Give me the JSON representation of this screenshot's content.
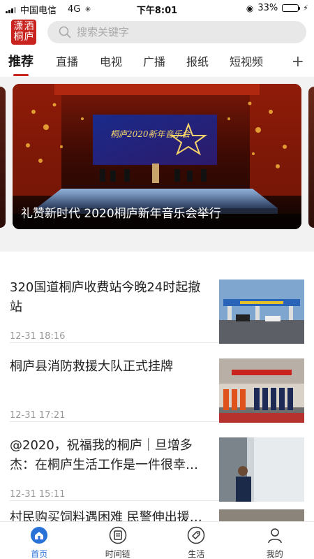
{
  "status_bar": {
    "carrier": "中国电信",
    "network": "4G",
    "time": "下午8:01",
    "battery": "33%",
    "battery_level": 0.33
  },
  "header": {
    "logo_text": "潇洒桐庐",
    "search_placeholder": "搜索关键字"
  },
  "tabs": [
    {
      "label": "推荐",
      "active": true
    },
    {
      "label": "直播"
    },
    {
      "label": "电视"
    },
    {
      "label": "广播"
    },
    {
      "label": "报纸"
    },
    {
      "label": "短视频"
    }
  ],
  "tab_add_label": "+",
  "carousel": {
    "caption": "礼赞新时代  2020桐庐新年音乐会举行",
    "banner_text": "桐庐2020新年音乐会"
  },
  "news": [
    {
      "title": "320国道桐庐收费站今晚24时起撤站",
      "time": "12-31 18:16"
    },
    {
      "title": "桐庐县消防救援大队正式挂牌",
      "time": "12-31 17:21"
    },
    {
      "title": "@2020，祝福我的桐庐｜旦增多杰：在桐庐生活工作是一件很幸…",
      "time": "12-31 15:11"
    },
    {
      "title": "村民购买饲料遇困难 民警伸出援…",
      "time": ""
    }
  ],
  "bottom_nav": [
    {
      "label": "首页",
      "icon": "home-icon",
      "active": true
    },
    {
      "label": "时间链",
      "icon": "timeline-icon"
    },
    {
      "label": "生活",
      "icon": "tag-icon"
    },
    {
      "label": "我的",
      "icon": "user-icon"
    }
  ],
  "colors": {
    "brand_red": "#c8231e",
    "nav_active": "#2a72d8"
  }
}
